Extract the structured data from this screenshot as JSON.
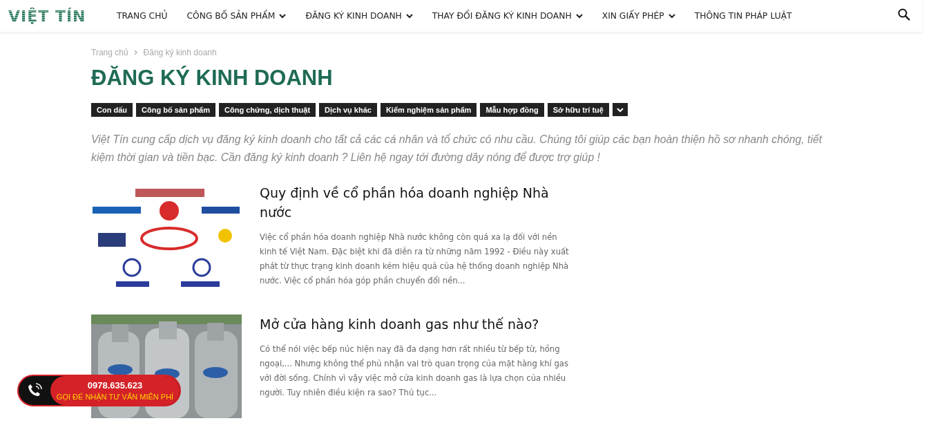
{
  "header": {
    "logo": "VIỆT TÍN",
    "nav": [
      {
        "label": "TRANG CHỦ",
        "has_dropdown": false
      },
      {
        "label": "CÔNG BỐ SẢN PHẨM",
        "has_dropdown": true
      },
      {
        "label": "ĐĂNG KÝ KINH DOANH",
        "has_dropdown": true
      },
      {
        "label": "THAY ĐỔI ĐĂNG KÝ KINH DOANH",
        "has_dropdown": true
      },
      {
        "label": "XIN GIẤY PHÉP",
        "has_dropdown": true
      },
      {
        "label": "THÔNG TIN PHÁP LUẬT",
        "has_dropdown": false
      }
    ]
  },
  "breadcrumb": [
    "Trang chủ",
    "Đăng ký kinh doanh"
  ],
  "title": "ĐĂNG KÝ KINH DOANH",
  "tags": [
    "Con dấu",
    "Công bố sản phẩm",
    "Công chứng, dịch thuật",
    "Dịch vụ khác",
    "Kiểm nghiệm sản phẩm",
    "Mẫu hợp đồng",
    "Sở hữu trí tuệ"
  ],
  "intro": "Việt Tín cung cấp dịch vụ đăng ký kinh doanh cho tất cả các cá nhân và tổ chức có nhu cầu. Chúng tôi giúp các bạn hoàn thiện hồ sơ nhanh chóng, tiết kiệm thời gian và tiền bạc. Cần đăng ký kinh doanh ? Liên hệ ngay tới đường dây nóng để được trợ giúp !",
  "articles": [
    {
      "kind": "logos",
      "title": "Quy định về cổ phần hóa doanh nghiệp Nhà nước",
      "excerpt": "Việc cổ phần hóa doanh nghiệp Nhà nước không còn quá xa lạ đối với nền kinh tế Việt Nam. Đặc biệt khi đã diễn ra từ những năm 1992 - Điều này xuất phát từ thực trạng kinh doanh kém hiệu quả của hệ thống doanh nghiệp Nhà nước. Việc cổ phần hóa góp phần chuyển đổi nền..."
    },
    {
      "kind": "cylinders",
      "title": "Mở cửa hàng kinh doanh gas như thế nào?",
      "excerpt": "Có thể nói việc bếp núc hiện nay đã đa dạng hơn rất nhiều từ bếp từ, hồng ngoại,... Nhưng không thể phủ nhận vai trò quan trọng của mặt hàng khí gas với đời sống. Chính vì vậy việc mở cửa kinh doanh gas là lựa chọn của nhiều người. Tuy nhiên điều kiện ra sao? Thủ tục..."
    }
  ],
  "hotline": {
    "phone": "0978.635.623",
    "caption": "GỌI ĐỂ NHẬN TƯ VẤN MIỄN PHÍ"
  }
}
